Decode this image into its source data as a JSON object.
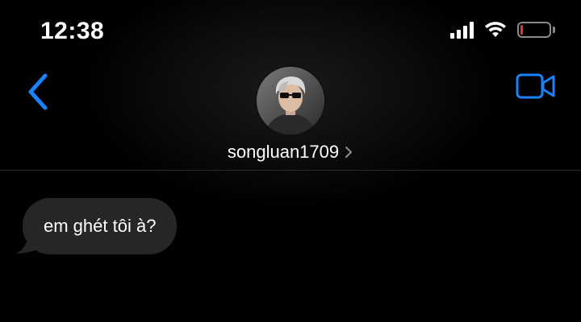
{
  "status_bar": {
    "time": "12:38",
    "battery_level": 0.05,
    "battery_color": "#e0362c"
  },
  "header": {
    "contact_name": "songluan1709",
    "accent_color": "#1a82fb",
    "icons": [
      "back-chevron-icon",
      "video-call-icon",
      "chevron-right-icon"
    ]
  },
  "messages": [
    {
      "direction": "incoming",
      "text": "em ghét tôi à?"
    }
  ]
}
